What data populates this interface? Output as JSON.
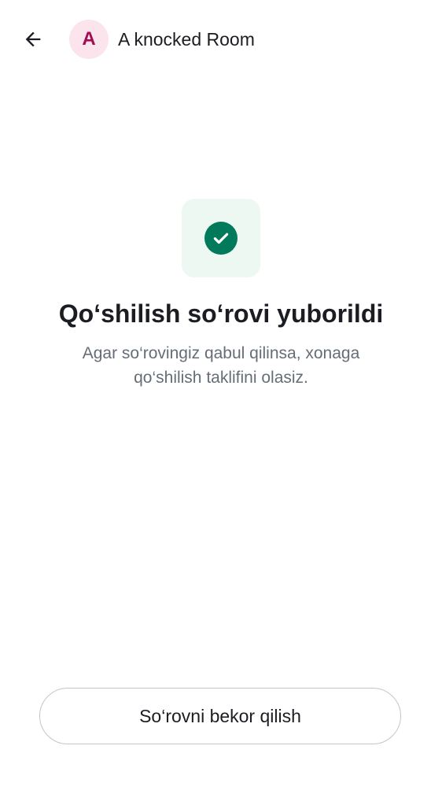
{
  "header": {
    "back_icon": "arrow-left-icon",
    "avatar_initial": "A",
    "room_name": "A knocked Room"
  },
  "status": {
    "icon": "check-circle-icon",
    "title": "Qo‘shilish so‘rovi yuborildi",
    "subtitle": "Agar so‘rovingiz qabul qilinsa, xonaga qo‘shilish taklifini olasiz."
  },
  "actions": {
    "cancel_label": "So‘rovni bekor qilish"
  },
  "colors": {
    "accent": "#007a5a",
    "accent_bg": "#eef8f3",
    "avatar_bg": "#fbe4ec",
    "avatar_fg": "#a30b52",
    "text_primary": "#1b1d22",
    "text_secondary": "#656d77"
  }
}
